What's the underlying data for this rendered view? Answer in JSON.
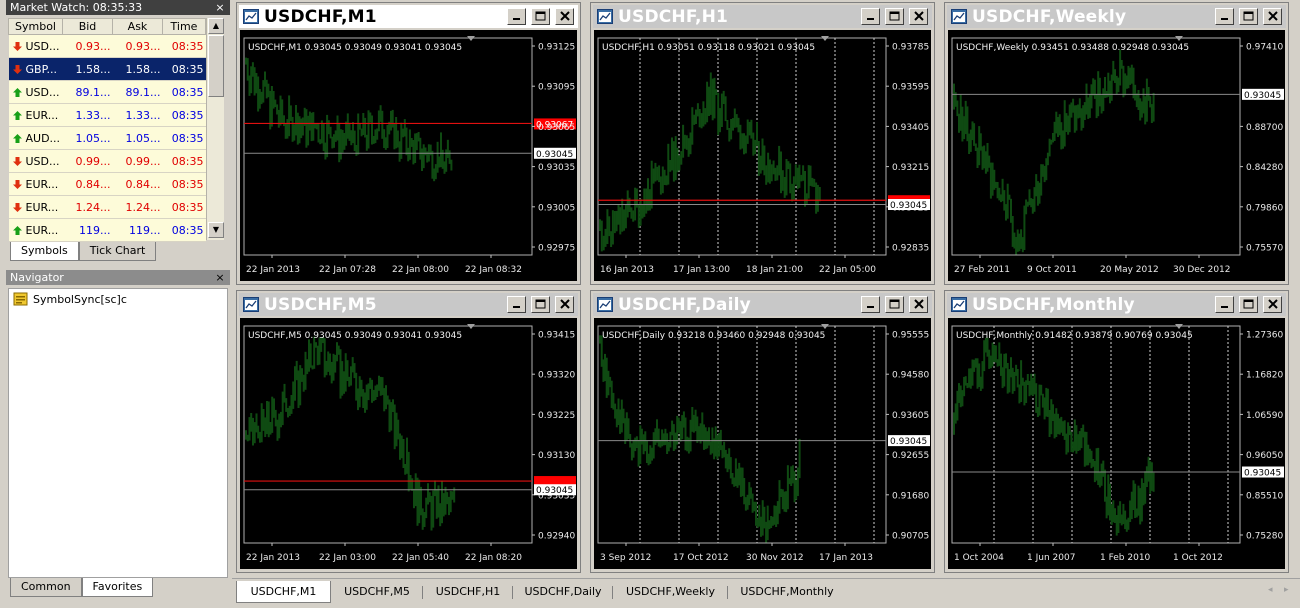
{
  "market_watch": {
    "title": "Market Watch: 08:35:33",
    "columns": [
      "Symbol",
      "Bid",
      "Ask",
      "Time"
    ],
    "rows": [
      {
        "symbol": "USD...",
        "bid": "0.93...",
        "ask": "0.93...",
        "time": "08:35",
        "dir": "down",
        "selected": false
      },
      {
        "symbol": "GBP...",
        "bid": "1.58...",
        "ask": "1.58...",
        "time": "08:35",
        "dir": "down",
        "selected": true
      },
      {
        "symbol": "USD...",
        "bid": "89.1...",
        "ask": "89.1...",
        "time": "08:35",
        "dir": "up",
        "selected": false
      },
      {
        "symbol": "EUR...",
        "bid": "1.33...",
        "ask": "1.33...",
        "time": "08:35",
        "dir": "up",
        "selected": false
      },
      {
        "symbol": "AUD...",
        "bid": "1.05...",
        "ask": "1.05...",
        "time": "08:35",
        "dir": "up",
        "selected": false
      },
      {
        "symbol": "USD...",
        "bid": "0.99...",
        "ask": "0.99...",
        "time": "08:35",
        "dir": "down",
        "selected": false
      },
      {
        "symbol": "EUR...",
        "bid": "0.84...",
        "ask": "0.84...",
        "time": "08:35",
        "dir": "down",
        "selected": false
      },
      {
        "symbol": "EUR...",
        "bid": "1.24...",
        "ask": "1.24...",
        "time": "08:35",
        "dir": "down",
        "selected": false
      },
      {
        "symbol": "EUR...",
        "bid": "119...",
        "ask": "119...",
        "time": "08:35",
        "dir": "up",
        "selected": false
      }
    ],
    "tabs": [
      "Symbols",
      "Tick Chart"
    ]
  },
  "navigator": {
    "title": "Navigator",
    "items": [
      "SymbolSync[sc]c"
    ],
    "tabs": [
      "Common",
      "Favorites"
    ]
  },
  "window_buttons": {
    "close": "×"
  },
  "scroll_arrows": {
    "up": "▲",
    "down": "▼"
  },
  "colors": {
    "candle": "#0f4a12",
    "bid_line": "#8a8a8a",
    "ask_line": "#e01010",
    "price_label_bg": "#ffffff",
    "ask_label_bg": "#ff0000",
    "active_title_bg": "#ffffff",
    "inactive_title_bg": "#c8c8c8"
  },
  "charts": [
    {
      "title": "USDCHF,M1",
      "ohlc": "USDCHF,M1  0.93045 0.93049 0.93041 0.93045",
      "active": true,
      "y_labels": [
        "0.93125",
        "0.93095",
        "0.93065",
        "0.93035",
        "0.93005",
        "0.92975"
      ],
      "y_range": [
        0.9297,
        0.9313
      ],
      "x_labels": [
        "22 Jan 2013",
        "22 Jan 07:28",
        "22 Jan 08:00",
        "22 Jan 08:32"
      ],
      "bid": 0.93045,
      "bid_label": "0.93045",
      "ask": 0.93067,
      "ask_label": "0.93067",
      "grid_v": false,
      "seed": 7,
      "trend": [
        0.9,
        0.65,
        0.6,
        0.55,
        0.62,
        0.5,
        0.45
      ],
      "series_end": 0.72
    },
    {
      "title": "USDCHF,H1",
      "ohlc": "USDCHF,H1  0.93051 0.93118 0.93021 0.93045",
      "active": false,
      "y_labels": [
        "0.93785",
        "0.93595",
        "0.93405",
        "0.93215",
        "0.93025",
        "0.92835"
      ],
      "y_range": [
        0.9281,
        0.9382
      ],
      "x_labels": [
        "16 Jan 2013",
        "17 Jan 13:00",
        "18 Jan 21:00",
        "22 Jan 05:00"
      ],
      "bid": 0.93045,
      "bid_label": "0.93045",
      "ask": 0.93065,
      "ask_label": "",
      "grid_v": true,
      "seed": 11,
      "trend": [
        0.1,
        0.25,
        0.45,
        0.75,
        0.55,
        0.4,
        0.3
      ],
      "series_end": 0.77
    },
    {
      "title": "USDCHF,Weekly",
      "ohlc": "USDCHF,Weekly  0.93451 0.93488 0.92948 0.93045",
      "active": false,
      "y_labels": [
        "0.97410",
        "0.93045",
        "0.88700",
        "0.84280",
        "0.79860",
        "0.75570"
      ],
      "y_range": [
        0.7535,
        0.9925
      ],
      "x_labels": [
        "27 Feb 2011",
        "9 Oct 2011",
        "20 May 2012",
        "30 Dec 2012"
      ],
      "bid": 0.93045,
      "bid_label": "0.93045",
      "ask": null,
      "ask_label": "",
      "grid_v": false,
      "seed": 23,
      "trend": [
        0.72,
        0.45,
        0.08,
        0.6,
        0.7,
        0.85,
        0.72
      ],
      "series_end": 0.7,
      "skip_tick": 1
    },
    {
      "title": "USDCHF,M5",
      "ohlc": "USDCHF,M5  0.93045 0.93049 0.93041 0.93045",
      "active": false,
      "y_labels": [
        "0.93415",
        "0.93320",
        "0.93225",
        "0.93130",
        "0.93035",
        "0.92940"
      ],
      "y_range": [
        0.9291,
        0.9346
      ],
      "x_labels": [
        "22 Jan 2013",
        "22 Jan 03:00",
        "22 Jan 05:40",
        "22 Jan 08:20"
      ],
      "bid": 0.93045,
      "bid_label": "0.93045",
      "ask": 0.93067,
      "ask_label": "",
      "grid_v": false,
      "seed": 31,
      "trend": [
        0.5,
        0.62,
        0.9,
        0.78,
        0.7,
        0.2,
        0.2
      ],
      "series_end": 0.73
    },
    {
      "title": "USDCHF,Daily",
      "ohlc": "USDCHF,Daily  0.93218 0.93460 0.92948 0.93045",
      "active": false,
      "y_labels": [
        "0.95555",
        "0.94580",
        "0.93605",
        "0.92655",
        "0.91680",
        "0.90705"
      ],
      "y_range": [
        0.9045,
        0.9595
      ],
      "x_labels": [
        "3 Sep 2012",
        "17 Oct 2012",
        "30 Nov 2012",
        "17 Jan 2013"
      ],
      "bid": 0.93045,
      "bid_label": "0.93045",
      "ask": null,
      "ask_label": "",
      "grid_v": true,
      "seed": 41,
      "trend": [
        0.88,
        0.45,
        0.5,
        0.55,
        0.35,
        0.1,
        0.38
      ],
      "series_end": 0.7
    },
    {
      "title": "USDCHF,Monthly",
      "ohlc": "USDCHF,Monthly  0.91482 0.93879 0.90769 0.93045",
      "active": false,
      "y_labels": [
        "1.27360",
        "1.16820",
        "1.06590",
        "0.96050",
        "0.85510",
        "0.75280"
      ],
      "y_range": [
        0.7435,
        1.315
      ],
      "x_labels": [
        "1 Oct 2004",
        "1 Jun 2007",
        "1 Feb 2010",
        "1 Oct 2012"
      ],
      "bid": 0.93045,
      "bid_label": "0.93045",
      "ask": null,
      "ask_label": "",
      "grid_v": true,
      "seed": 53,
      "trend": [
        0.68,
        0.88,
        0.75,
        0.6,
        0.45,
        0.12,
        0.33
      ],
      "series_end": 0.7
    }
  ],
  "chart_tabs": [
    "USDCHF,M1",
    "USDCHF,M5",
    "USDCHF,H1",
    "USDCHF,Daily",
    "USDCHF,Weekly",
    "USDCHF,Monthly"
  ],
  "active_chart_tab": 0,
  "tab_nav": {
    "prev": "◂",
    "next": "▸"
  }
}
